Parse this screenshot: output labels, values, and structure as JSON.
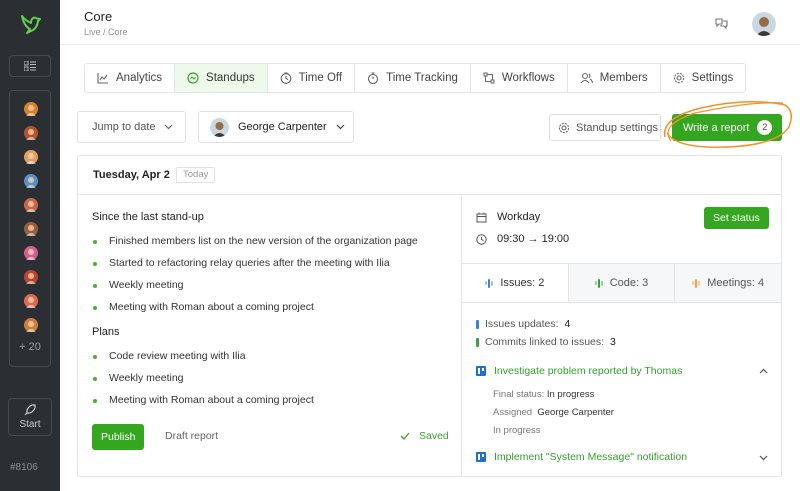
{
  "app": {
    "title": "Core",
    "breadcrumb": "Live / Core",
    "version": "#8106"
  },
  "sidebar": {
    "more_label": "+ 20",
    "start_label": "Start",
    "avatar_colors": [
      "#d9822b",
      "#b3552a",
      "#e0a060",
      "#5b8fc7",
      "#c76a4a",
      "#9a5e3a",
      "#d35f8c",
      "#b9472e",
      "#e06a4f",
      "#cf7f3a"
    ]
  },
  "tabs": [
    {
      "label": "Analytics",
      "icon": "chart-line-icon"
    },
    {
      "label": "Standups",
      "icon": "standup-icon"
    },
    {
      "label": "Time Off",
      "icon": "clock-icon"
    },
    {
      "label": "Time Tracking",
      "icon": "stopwatch-icon"
    },
    {
      "label": "Workflows",
      "icon": "workflow-icon"
    },
    {
      "label": "Members",
      "icon": "members-icon"
    },
    {
      "label": "Settings",
      "icon": "gear-icon"
    }
  ],
  "toolbar": {
    "jump_label": "Jump to date",
    "member_name": "George Carpenter",
    "standup_settings_label": "Standup settings",
    "write_report_label": "Write a report",
    "write_report_count": "2"
  },
  "report": {
    "date": "Tuesday, Apr 2",
    "today_label": "Today",
    "since_title": "Since the last stand-up",
    "since_items": [
      "Finished members list on the new version of the organization page",
      "Started to refactoring relay queries after the meeting with Ilia",
      "Weekly meeting",
      "Meeting with Roman about a coming project"
    ],
    "plans_title": "Plans",
    "plans_items": [
      "Code review meeting with Ilia",
      "Weekly meeting",
      "Meeting with Roman about a coming project"
    ],
    "publish_label": "Publish",
    "draft_label": "Draft report",
    "saved_label": "Saved"
  },
  "workday": {
    "label": "Workday",
    "time": "09:30 → 19:00",
    "set_status_label": "Set status"
  },
  "stat_tabs": [
    {
      "label": "Issues: 2",
      "color": "#3b82d6"
    },
    {
      "label": "Code: 3",
      "color": "#39a33a"
    },
    {
      "label": "Meetings: 4",
      "color": "#f0a23b"
    }
  ],
  "stats": {
    "issues_updates_label": "Issues updates:",
    "issues_updates_value": "4",
    "commits_label": "Commits linked to issues:",
    "commits_value": "3"
  },
  "issues": [
    {
      "title": "Investigate problem reported by Thomas",
      "final_status_label": "Final status:",
      "final_status": "In progress",
      "assigned_label": "Assigned",
      "assignee": "George Carpenter",
      "status": "In progress"
    },
    {
      "title": "Implement \"System Message\" notification"
    }
  ]
}
